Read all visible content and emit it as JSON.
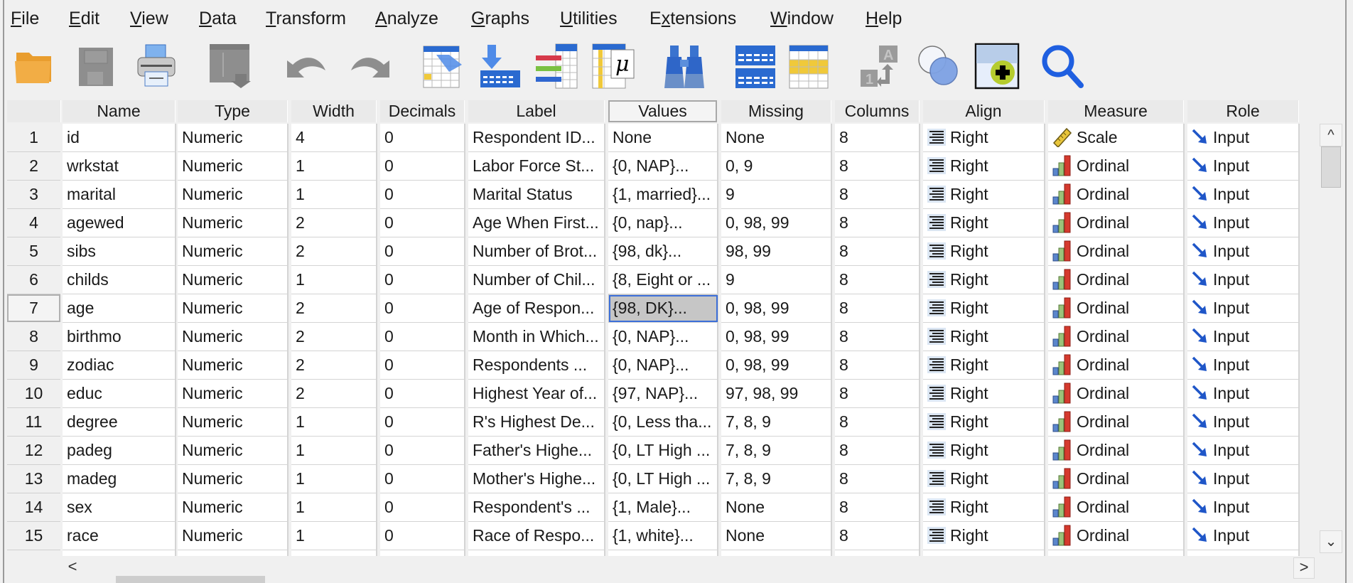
{
  "menu": [
    {
      "label": "File",
      "mnemonic": "F",
      "rest": "ile"
    },
    {
      "label": "Edit",
      "mnemonic": "E",
      "rest": "dit"
    },
    {
      "label": "View",
      "mnemonic": "V",
      "rest": "iew"
    },
    {
      "label": "Data",
      "mnemonic": "D",
      "rest": "ata"
    },
    {
      "label": "Transform",
      "mnemonic": "T",
      "rest": "ransform"
    },
    {
      "label": "Analyze",
      "mnemonic": "A",
      "rest": "nalyze"
    },
    {
      "label": "Graphs",
      "mnemonic": "G",
      "rest": "raphs"
    },
    {
      "label": "Utilities",
      "mnemonic": "U",
      "rest": "tilities"
    },
    {
      "label": "Extensions",
      "pre": "E",
      "mnemonic": "x",
      "rest": "tensions"
    },
    {
      "label": "Window",
      "mnemonic": "W",
      "rest": "indow"
    },
    {
      "label": "Help",
      "mnemonic": "H",
      "rest": "elp"
    }
  ],
  "toolbar": [
    {
      "icon": "open-folder-icon",
      "enabled": true
    },
    {
      "icon": "save-icon",
      "enabled": false
    },
    {
      "icon": "print-icon",
      "enabled": true
    },
    {
      "icon": "recall-dialog-icon",
      "enabled": false
    },
    {
      "icon": "undo-icon",
      "enabled": false
    },
    {
      "icon": "redo-icon",
      "enabled": false
    },
    {
      "icon": "go-to-case-icon",
      "enabled": true
    },
    {
      "icon": "go-to-variable-icon",
      "enabled": true
    },
    {
      "icon": "variables-icon",
      "enabled": true
    },
    {
      "icon": "descriptive-statistics-icon",
      "enabled": true
    },
    {
      "icon": "find-binoculars-icon",
      "enabled": true
    },
    {
      "icon": "split-file-icon",
      "enabled": true
    },
    {
      "icon": "select-cases-icon",
      "enabled": true
    },
    {
      "icon": "value-labels-icon",
      "enabled": false
    },
    {
      "icon": "use-variable-sets-icon",
      "enabled": true
    },
    {
      "icon": "customize-toolbar-icon",
      "enabled": true
    },
    {
      "icon": "search-icon",
      "enabled": true
    }
  ],
  "columns": [
    "Name",
    "Type",
    "Width",
    "Decimals",
    "Label",
    "Values",
    "Missing",
    "Columns",
    "Align",
    "Measure",
    "Role"
  ],
  "selected_column": "Values",
  "selected_row": 7,
  "rows": [
    {
      "n": "1",
      "name": "id",
      "type": "Numeric",
      "width": "4",
      "decimals": "0",
      "label": "Respondent ID...",
      "values": "None",
      "missing": "None",
      "columns": "8",
      "align": "Right",
      "measure": "Scale",
      "role": "Input"
    },
    {
      "n": "2",
      "name": "wrkstat",
      "type": "Numeric",
      "width": "1",
      "decimals": "0",
      "label": "Labor Force St...",
      "values": "{0, NAP}...",
      "missing": "0, 9",
      "columns": "8",
      "align": "Right",
      "measure": "Ordinal",
      "role": "Input"
    },
    {
      "n": "3",
      "name": "marital",
      "type": "Numeric",
      "width": "1",
      "decimals": "0",
      "label": "Marital Status",
      "values": "{1, married}...",
      "missing": "9",
      "columns": "8",
      "align": "Right",
      "measure": "Ordinal",
      "role": "Input"
    },
    {
      "n": "4",
      "name": "agewed",
      "type": "Numeric",
      "width": "2",
      "decimals": "0",
      "label": "Age When First...",
      "values": "{0, nap}...",
      "missing": "0, 98, 99",
      "columns": "8",
      "align": "Right",
      "measure": "Ordinal",
      "role": "Input"
    },
    {
      "n": "5",
      "name": "sibs",
      "type": "Numeric",
      "width": "2",
      "decimals": "0",
      "label": "Number of Brot...",
      "values": "{98, dk}...",
      "missing": "98, 99",
      "columns": "8",
      "align": "Right",
      "measure": "Ordinal",
      "role": "Input"
    },
    {
      "n": "6",
      "name": "childs",
      "type": "Numeric",
      "width": "1",
      "decimals": "0",
      "label": "Number of Chil...",
      "values": "{8, Eight or ...",
      "missing": "9",
      "columns": "8",
      "align": "Right",
      "measure": "Ordinal",
      "role": "Input"
    },
    {
      "n": "7",
      "name": "age",
      "type": "Numeric",
      "width": "2",
      "decimals": "0",
      "label": "Age of Respon...",
      "values": "{98, DK}...",
      "missing": "0, 98, 99",
      "columns": "8",
      "align": "Right",
      "measure": "Ordinal",
      "role": "Input"
    },
    {
      "n": "8",
      "name": "birthmo",
      "type": "Numeric",
      "width": "2",
      "decimals": "0",
      "label": "Month in Which...",
      "values": "{0, NAP}...",
      "missing": "0, 98, 99",
      "columns": "8",
      "align": "Right",
      "measure": "Ordinal",
      "role": "Input"
    },
    {
      "n": "9",
      "name": "zodiac",
      "type": "Numeric",
      "width": "2",
      "decimals": "0",
      "label": "Respondents ...",
      "values": "{0, NAP}...",
      "missing": "0, 98, 99",
      "columns": "8",
      "align": "Right",
      "measure": "Ordinal",
      "role": "Input"
    },
    {
      "n": "10",
      "name": "educ",
      "type": "Numeric",
      "width": "2",
      "decimals": "0",
      "label": "Highest Year of...",
      "values": "{97, NAP}...",
      "missing": "97, 98, 99",
      "columns": "8",
      "align": "Right",
      "measure": "Ordinal",
      "role": "Input"
    },
    {
      "n": "11",
      "name": "degree",
      "type": "Numeric",
      "width": "1",
      "decimals": "0",
      "label": "R's Highest De...",
      "values": "{0, Less tha...",
      "missing": "7, 8, 9",
      "columns": "8",
      "align": "Right",
      "measure": "Ordinal",
      "role": "Input"
    },
    {
      "n": "12",
      "name": "padeg",
      "type": "Numeric",
      "width": "1",
      "decimals": "0",
      "label": "Father's Highe...",
      "values": "{0, LT High ...",
      "missing": "7, 8, 9",
      "columns": "8",
      "align": "Right",
      "measure": "Ordinal",
      "role": "Input"
    },
    {
      "n": "13",
      "name": "madeg",
      "type": "Numeric",
      "width": "1",
      "decimals": "0",
      "label": "Mother's Highe...",
      "values": "{0, LT High ...",
      "missing": "7, 8, 9",
      "columns": "8",
      "align": "Right",
      "measure": "Ordinal",
      "role": "Input"
    },
    {
      "n": "14",
      "name": "sex",
      "type": "Numeric",
      "width": "1",
      "decimals": "0",
      "label": "Respondent's ...",
      "values": "{1, Male}...",
      "missing": "None",
      "columns": "8",
      "align": "Right",
      "measure": "Ordinal",
      "role": "Input"
    },
    {
      "n": "15",
      "name": "race",
      "type": "Numeric",
      "width": "1",
      "decimals": "0",
      "label": "Race of Respo...",
      "values": "{1, white}...",
      "missing": "None",
      "columns": "8",
      "align": "Right",
      "measure": "Ordinal",
      "role": "Input"
    }
  ],
  "scrollbars": {
    "up": "^",
    "down": "⌄",
    "left": "<",
    "right": ">"
  },
  "colors": {
    "selection_border": "#3c6fd8",
    "selection_fill": "#c6c6c6",
    "folder": "#f0a83a",
    "search": "#1f5fe0"
  }
}
